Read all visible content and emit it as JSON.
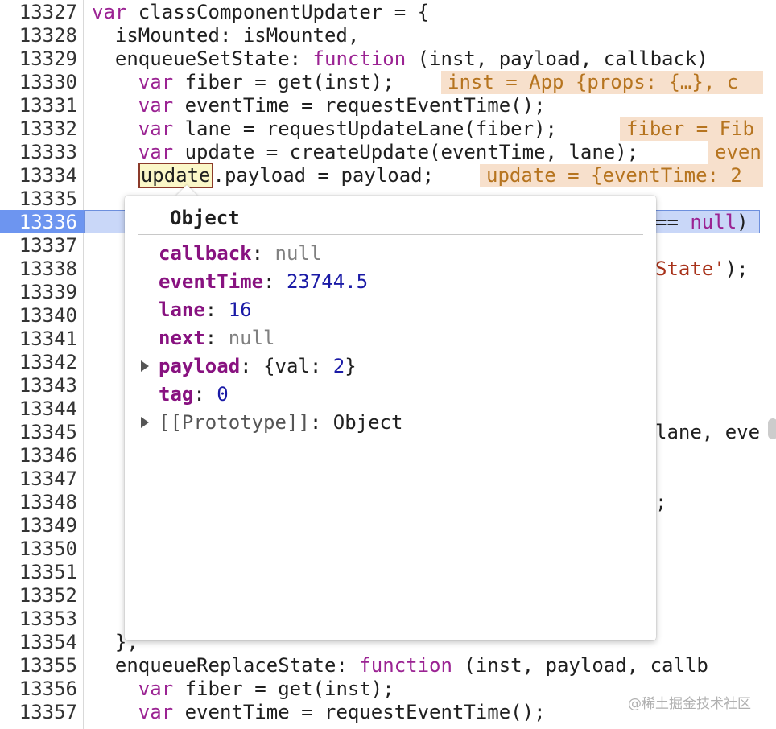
{
  "line_numbers": [
    "13327",
    "13328",
    "13329",
    "13330",
    "13331",
    "13332",
    "13333",
    "13334",
    "13335",
    "13336",
    "13337",
    "13338",
    "13339",
    "13340",
    "13341",
    "13342",
    "13343",
    "13344",
    "13345",
    "13346",
    "13347",
    "13348",
    "13349",
    "13350",
    "13351",
    "13352",
    "13353",
    "13354",
    "13355",
    "13356",
    "13357"
  ],
  "active_line": "13336",
  "code": {
    "l1_kw": "var",
    "l1_rest": " classComponentUpdater = {",
    "l2": "  isMounted: isMounted,",
    "l3_a": "  enqueueSetState: ",
    "l3_kw": "function",
    "l3_b": " (inst, payload, callback)",
    "l4_kw": "var",
    "l4_rest": " fiber = get(inst);",
    "l5_kw": "var",
    "l5_rest": " eventTime = requestEventTime();",
    "l6_kw": "var",
    "l6_rest": " lane = requestUpdateLane(fiber);",
    "l7_kw": "var",
    "l7_rest": " update = createUpdate(eventTime, lane);",
    "l8_tok": "update",
    "l8_rest": ".payload = payload;",
    "l10_tail_a": "== ",
    "l10_tail_null": "null",
    "l10_tail_b": ")",
    "l12_tail_str": "State'",
    "l12_tail_b": ");",
    "l19_tail": "lane, eve",
    "l22_tail": ";",
    "l28": "  },",
    "l29_a": "  enqueueReplaceState: ",
    "l29_kw": "function",
    "l29_b": " (inst, payload, callb",
    "l30_kw": "var",
    "l30_rest": " fiber = get(inst);",
    "l31_kw": "var",
    "l31_rest": " eventTime = requestEventTime();"
  },
  "inline_values": {
    "v4": "inst = App {props: {…}, c",
    "v6": "fiber = Fib",
    "v7": "even",
    "v8": "update = {eventTime: 2"
  },
  "popover": {
    "title": "Object",
    "props": [
      {
        "key": "callback",
        "value": "null",
        "kind": "null"
      },
      {
        "key": "eventTime",
        "value": "23744.5",
        "kind": "number"
      },
      {
        "key": "lane",
        "value": "16",
        "kind": "number"
      },
      {
        "key": "next",
        "value": "null",
        "kind": "null"
      },
      {
        "key": "payload",
        "value_a": "{val: ",
        "value_num": "2",
        "value_b": "}",
        "kind": "object",
        "expandable": true
      },
      {
        "key": "tag",
        "value": "0",
        "kind": "number"
      }
    ],
    "prototype_label": "[[Prototype]]",
    "prototype_value": "Object"
  },
  "watermark": "@稀土掘金技术社区",
  "colors": {
    "keyword": "#9b2393",
    "highlight_line": "#c9d7f8",
    "gutter_active": "#6d95f0",
    "inline_value_bg": "#f7e0cc",
    "prop_key": "#881280",
    "number": "#1a1aa6"
  }
}
